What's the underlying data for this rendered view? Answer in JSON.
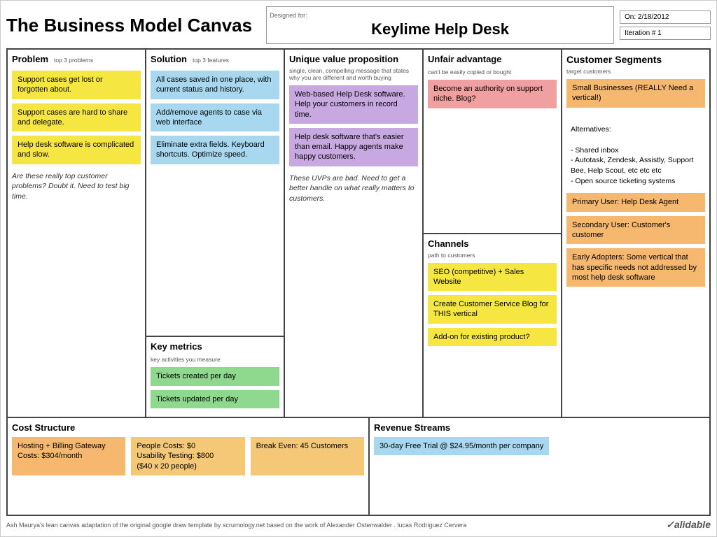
{
  "header": {
    "title": "The Business Model Canvas",
    "designed_for_label": "Designed for:",
    "designed_for_value": "Keylime Help Desk",
    "on_label": "On:",
    "on_value": "2/18/2012",
    "iteration_label": "Iteration #",
    "iteration_value": "1"
  },
  "problem": {
    "header": "Problem",
    "subheader": "top 3 problems",
    "sticky1": "Support cases get lost or forgotten about.",
    "sticky2": "Support cases are hard to share and delegate.",
    "sticky3": "Help desk software is complicated and slow.",
    "italic_note": "Are these really top customer problems? Doubt it.  Need to test big time."
  },
  "solution": {
    "header": "Solution",
    "subheader": "top 3 features",
    "sticky1": "All cases saved in one place, with current status and history.",
    "sticky2": "Add/remove agents to case via web interface",
    "sticky3": "Eliminate extra fields. Keyboard shortcuts. Optimize speed."
  },
  "key_metrics": {
    "header": "Key metrics",
    "subheader": "key activities you measure",
    "sticky1": "Tickets created per day",
    "sticky2": "Tickets updated per day"
  },
  "uvp": {
    "header": "Unique value proposition",
    "subheader": "single, clean, compelling message that states why you are different and worth buying",
    "sticky1": "Web-based Help Desk software. Help your customers in record time.",
    "sticky2": "Help desk software that's easier than email. Happy agents make happy customers.",
    "italic_note": "These UVPs are bad. Need to get a better handle on what really matters to customers."
  },
  "unfair_advantage": {
    "header": "Unfair advantage",
    "subheader": "can't be easily copied or bought",
    "sticky1": "Become an authority on support niche. Blog?"
  },
  "channels": {
    "header": "Channels",
    "subheader": "path to customers",
    "sticky1": "SEO (competitive) + Sales Website",
    "sticky2": "Create Customer Service Blog for THIS vertical",
    "sticky3": "Add-on for existing product?"
  },
  "customer_segments": {
    "header": "Customer Segments",
    "subheader": "target customers",
    "sticky1": "Small Businesses (REALLY Need a vertical!)",
    "alternatives_label": "Alternatives:",
    "alternatives_text": "- Shared inbox\n- Autotask, Zendesk, Assistly, Support Bee, Help Scout, etc etc etc\n- Open source ticketing systems",
    "sticky2": "Primary User: Help Desk Agent",
    "sticky3": "Secondary User: Customer's customer",
    "sticky4": "Early Adopters: Some vertical that has specific needs not addressed by most help desk software"
  },
  "cost_structure": {
    "header": "Cost Structure",
    "sticky1": "Hosting + Billing Gateway Costs: $304/month",
    "sticky2": "People Costs: $0\nUsability Testing: $800\n($40 x 20 people)",
    "sticky3": "Break Even:  45 Customers"
  },
  "revenue_streams": {
    "header": "Revenue Streams",
    "sticky1": "30-day Free Trial @ $24.95/month per company"
  },
  "footer": {
    "text": "Ash Maurya's lean canvas adaptation of the original google draw template by scrumology.net based on the work of Alexander Ostenwalder . lucas Rodriguez Cervera",
    "logo": "validable"
  }
}
